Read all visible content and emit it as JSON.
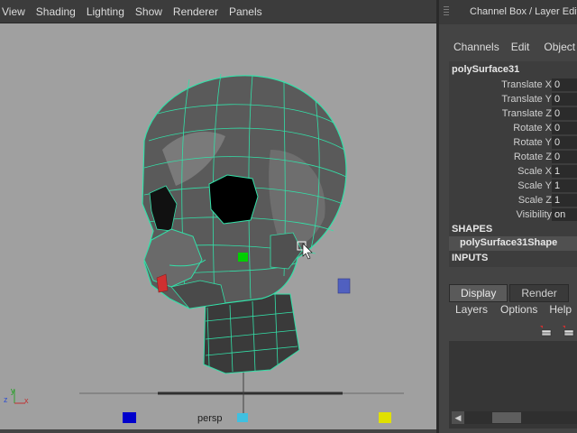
{
  "viewport": {
    "menu": [
      "View",
      "Shading",
      "Lighting",
      "Show",
      "Renderer",
      "Panels"
    ],
    "camera_label": "persp",
    "axis_labels": {
      "z": "z",
      "y": "y",
      "x": "x"
    }
  },
  "channel_box": {
    "title": "Channel Box / Layer Edito",
    "menu": [
      "Channels",
      "Edit",
      "Object"
    ],
    "object_name": "polySurface31",
    "attributes": [
      {
        "label": "Translate X",
        "value": "0"
      },
      {
        "label": "Translate Y",
        "value": "0"
      },
      {
        "label": "Translate Z",
        "value": "0"
      },
      {
        "label": "Rotate X",
        "value": "0"
      },
      {
        "label": "Rotate Y",
        "value": "0"
      },
      {
        "label": "Rotate Z",
        "value": "0"
      },
      {
        "label": "Scale X",
        "value": "1"
      },
      {
        "label": "Scale Y",
        "value": "1"
      },
      {
        "label": "Scale Z",
        "value": "1"
      },
      {
        "label": "Visibility",
        "value": "on"
      }
    ],
    "shapes_label": "SHAPES",
    "shape_name": "polySurface31Shape",
    "inputs_label": "INPUTS"
  },
  "layer_editor": {
    "tabs": [
      "Display",
      "Render"
    ],
    "active_tab": "Display",
    "menu": [
      "Layers",
      "Options",
      "Help"
    ],
    "icons": [
      "new-layer-icon",
      "new-layer-from-selected-icon"
    ]
  },
  "colors": {
    "wireframe": "#33e0a8",
    "viewport_bg": "#a0a0a0",
    "manipulator_green": "#00d000",
    "manipulator_red": "#d03030",
    "manipulator_blue": "#5060c0",
    "manipulator_yellow": "#e0e000"
  }
}
